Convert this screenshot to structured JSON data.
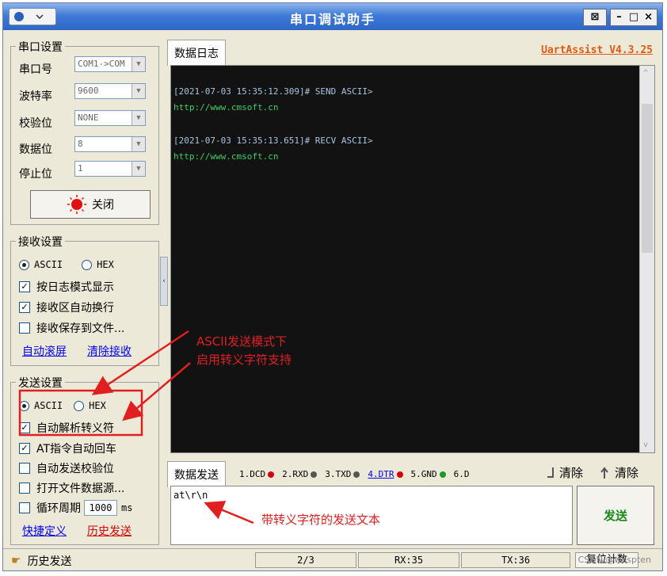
{
  "window": {
    "title": "串口调试助手",
    "version": "UartAssist V4.3.25",
    "ctrl_pin": "⊠",
    "ctrl_min": "–",
    "ctrl_max": "□",
    "ctrl_close": "×"
  },
  "serial": {
    "group_title": "串口设置",
    "port_label": "串口号",
    "port_value": "COM1->COM",
    "baud_label": "波特率",
    "baud_value": "9600",
    "parity_label": "校验位",
    "parity_value": "NONE",
    "databits_label": "数据位",
    "databits_value": "8",
    "stopbits_label": "停止位",
    "stopbits_value": "1",
    "close_button": "关闭"
  },
  "receive": {
    "group_title": "接收设置",
    "ascii": "ASCII",
    "hex": "HEX",
    "opt_log": "按日志模式显示",
    "opt_wrap": "接收区自动换行",
    "opt_save": "接收保存到文件...",
    "auto_scroll": "自动滚屏",
    "clear_recv": "清除接收"
  },
  "send": {
    "group_title": "发送设置",
    "ascii": "ASCII",
    "hex": "HEX",
    "opt_escape": "自动解析转义符",
    "opt_at": "AT指令自动回车",
    "opt_checksum": "自动发送校验位",
    "opt_file": "打开文件数据源...",
    "opt_cycle": "循环周期",
    "cycle_value": "1000",
    "cycle_unit": "ms",
    "shortcut": "快捷定义",
    "history": "历史发送"
  },
  "log": {
    "tab_label": "数据日志",
    "lines": [
      {
        "header": "[2021-07-03 15:35:12.309]# SEND ASCII>",
        "body": "http://www.cmsoft.cn"
      },
      {
        "header": "[2021-07-03 15:35:13.651]# RECV ASCII>",
        "body": "http://www.cmsoft.cn"
      }
    ]
  },
  "sendpanel": {
    "tab_label": "数据发送",
    "signals": [
      {
        "label": "1.DCD",
        "color": "#d00000"
      },
      {
        "label": "2.RXD",
        "color": "#555555"
      },
      {
        "label": "3.TXD",
        "color": "#555555"
      },
      {
        "label": "4.DTR",
        "color": "#d00000"
      },
      {
        "label": "5.GND",
        "color": "#1a9a2a"
      },
      {
        "label": "6.D",
        "color": "#555555"
      }
    ],
    "clear1": "清除",
    "clear2": "清除",
    "text": "at\\r\\n",
    "send_button": "发送"
  },
  "statusbar": {
    "history": "历史发送",
    "page": "2/3",
    "rx": "RX:35",
    "tx": "TX:36",
    "reset": "复位计数"
  },
  "annotations": {
    "note1_line1": "ASCII发送模式下",
    "note1_line2": "启用转义字符支持",
    "note2": "带转义字符的发送文本"
  },
  "watermark": "CSDN @wespten",
  "colors": {
    "accent": "#e02020",
    "title_bar": "#3f7bd8",
    "log_text": "#a9c4e0",
    "log_body": "#3ad06a"
  }
}
